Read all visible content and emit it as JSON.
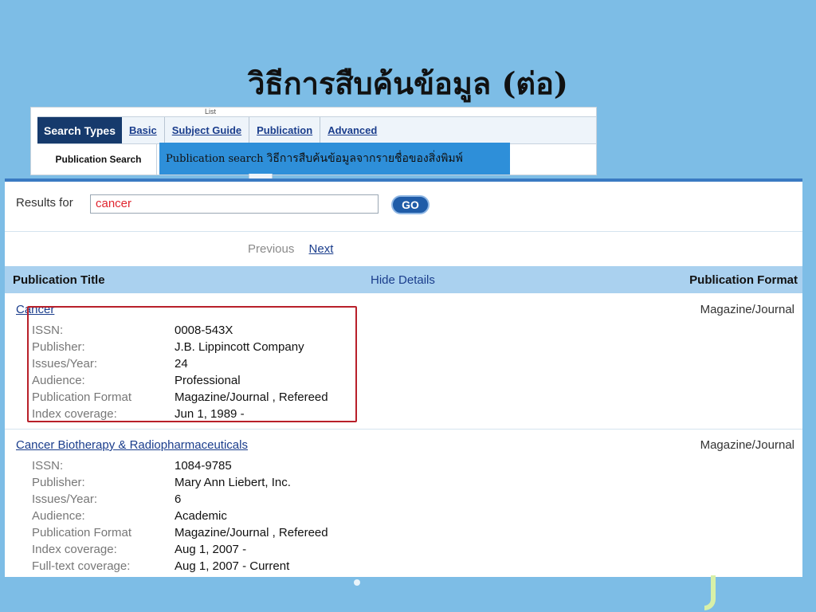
{
  "slide": {
    "title": "วิธีการสืบค้นข้อมูล (ต่อ)",
    "callout": {
      "prefix": "Publication search",
      "thai_text": "วิธีการสืบค้นข้อมูลจากรายชื่อของสิ่งพิมพ์"
    }
  },
  "search_tabs": {
    "list_label": "List",
    "header": "Search Types",
    "tabs": [
      {
        "label": "Basic"
      },
      {
        "label": "Subject Guide"
      },
      {
        "label": "Publication"
      },
      {
        "label": "Advanced"
      }
    ],
    "active_subtab": "Publication Search"
  },
  "results": {
    "results_for_label": "Results for",
    "query": "cancer",
    "go_label": "GO",
    "previous_label": "Previous",
    "next_label": "Next",
    "columns": {
      "title": "Publication Title",
      "hide_details": "Hide Details",
      "format": "Publication Format"
    },
    "records": [
      {
        "title": "Cancer",
        "format": "Magazine/Journal",
        "details": [
          {
            "label": "ISSN:",
            "value": "0008-543X"
          },
          {
            "label": "Publisher:",
            "value": "J.B. Lippincott Company"
          },
          {
            "label": "Issues/Year:",
            "value": "24"
          },
          {
            "label": "Audience:",
            "value": "Professional"
          },
          {
            "label": "Publication Format",
            "value": "Magazine/Journal , Refereed"
          },
          {
            "label": "Index coverage:",
            "value": "Jun 1, 1989 -"
          }
        ]
      },
      {
        "title": "Cancer Biotherapy & Radiopharmaceuticals",
        "format": "Magazine/Journal",
        "details": [
          {
            "label": "ISSN:",
            "value": "1084-9785"
          },
          {
            "label": "Publisher:",
            "value": "Mary Ann Liebert, Inc."
          },
          {
            "label": "Issues/Year:",
            "value": "6"
          },
          {
            "label": "Audience:",
            "value": "Academic"
          },
          {
            "label": "Publication Format",
            "value": "Magazine/Journal , Refereed"
          },
          {
            "label": "Index coverage:",
            "value": "Aug 1, 2007 -"
          },
          {
            "label": "Full-text coverage:",
            "value": "Aug 1, 2007 - Current"
          }
        ]
      }
    ]
  },
  "colors": {
    "background": "#7dbde6",
    "highlight": "#b8202a",
    "link": "#1a3d8c",
    "header_band": "#aad1ef"
  }
}
